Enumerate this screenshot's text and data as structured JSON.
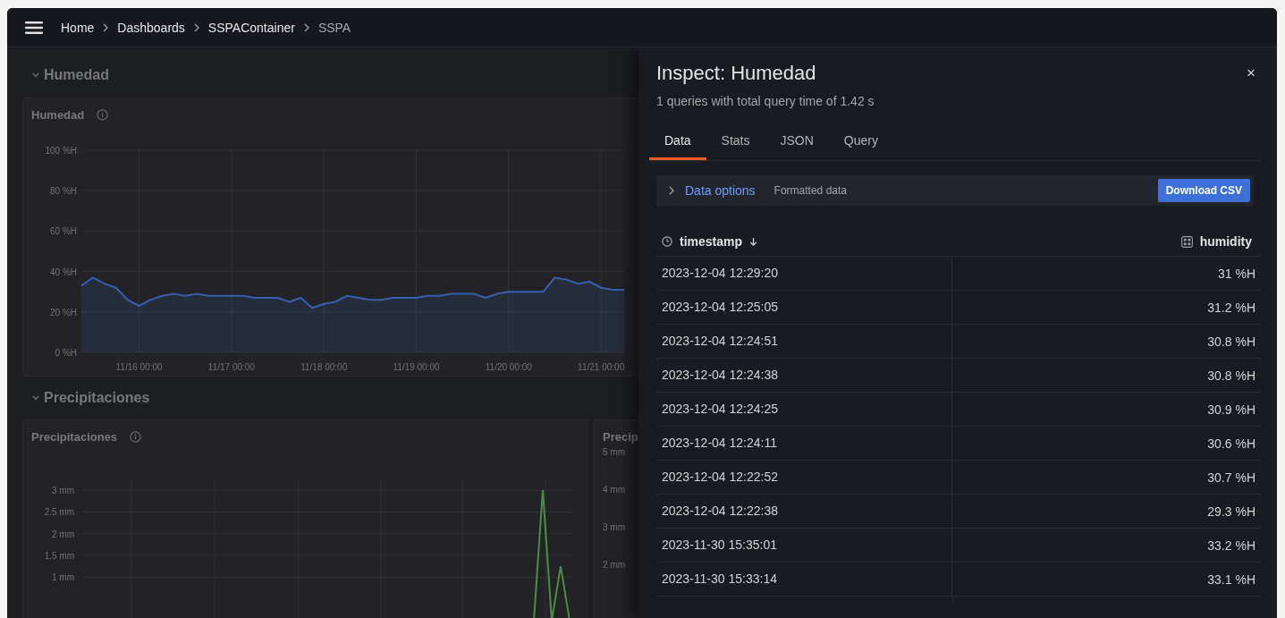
{
  "breadcrumbs": [
    {
      "label": "Home",
      "current": false
    },
    {
      "label": "Dashboards",
      "current": false
    },
    {
      "label": "SSPAContainer",
      "current": false
    },
    {
      "label": "SSPA",
      "current": true
    }
  ],
  "rows": [
    {
      "title": "Humedad",
      "expanded": true,
      "panels": [
        {
          "title": "Humedad",
          "chart_data": {
            "type": "area",
            "grid": true,
            "ylim": [
              0,
              100
            ],
            "yticks": [
              {
                "value": 0,
                "label": "0 %H"
              },
              {
                "value": 20,
                "label": "20 %H"
              },
              {
                "value": 40,
                "label": "40 %H"
              },
              {
                "value": 60,
                "label": "60 %H"
              },
              {
                "value": 80,
                "label": "80 %H"
              },
              {
                "value": 100,
                "label": "100 %H"
              }
            ],
            "categories": [
              null,
              null,
              null,
              null,
              null,
              "11/16 00:00",
              null,
              null,
              null,
              null,
              null,
              null,
              null,
              "11/17 00:00",
              null,
              null,
              null,
              null,
              null,
              null,
              null,
              "11/18 00:00",
              null,
              null,
              null,
              null,
              null,
              null,
              null,
              "11/19 00:00",
              null,
              null,
              null,
              null,
              null,
              null,
              null,
              "11/20 00:00",
              null,
              null,
              null,
              null,
              null,
              null,
              null,
              "11/21 00:00",
              null,
              null
            ],
            "series": [
              {
                "color": "#3d71d9",
                "values": [
                  33,
                  37,
                  34,
                  32,
                  26,
                  23,
                  26,
                  28,
                  29,
                  28,
                  29,
                  28,
                  28,
                  28,
                  28,
                  27,
                  27,
                  27,
                  25,
                  27,
                  22,
                  24,
                  25,
                  28,
                  27,
                  26,
                  26,
                  27,
                  27,
                  27,
                  28,
                  28,
                  29,
                  29,
                  29,
                  27,
                  29,
                  30,
                  30,
                  30,
                  30,
                  37,
                  36,
                  34,
                  35,
                  32,
                  31,
                  31
                ]
              }
            ]
          }
        }
      ]
    },
    {
      "title": "Precipitaciones",
      "expanded": true,
      "panels": [
        {
          "title": "Precipitaciones",
          "chart_data": {
            "type": "line",
            "grid": true,
            "ylim": [
              0,
              3.3
            ],
            "yticks": [
              {
                "value": 1,
                "label": "1 mm"
              },
              {
                "value": 1.5,
                "label": "1.5 mm"
              },
              {
                "value": 2,
                "label": "2 mm"
              },
              {
                "value": 2.5,
                "label": "2.5 mm"
              },
              {
                "value": 3,
                "label": "3 mm"
              }
            ],
            "series": [
              {
                "color": "#56a64b",
                "values": [
                  null,
                  null,
                  null,
                  null,
                  null,
                  null,
                  null,
                  null,
                  null,
                  null,
                  null,
                  null,
                  null,
                  null,
                  null,
                  null,
                  null,
                  null,
                  null,
                  null,
                  null,
                  null,
                  null,
                  null,
                  null,
                  null,
                  null,
                  null,
                  null,
                  null,
                  null,
                  null,
                  null,
                  null,
                  null,
                  null,
                  null,
                  null,
                  null,
                  null,
                  null,
                  null,
                  null,
                  null,
                  null,
                  null,
                  null,
                  null,
                  null,
                  null,
                  null,
                  0,
                  3,
                  0,
                  1.25,
                  0
                ]
              }
            ]
          }
        },
        {
          "title": "Precip",
          "axis_labels": [
            "5 mm",
            "4 mm",
            "3 mm",
            "2 mm"
          ]
        }
      ]
    }
  ],
  "inspect": {
    "title": "Inspect: Humedad",
    "close": "×",
    "subtitle": "1 queries with total query time of 1.42 s",
    "tabs": [
      {
        "label": "Data",
        "selected": true
      },
      {
        "label": "Stats",
        "selected": false
      },
      {
        "label": "JSON",
        "selected": false
      },
      {
        "label": "Query",
        "selected": false
      }
    ],
    "options": {
      "label": "Data options",
      "hint": "Formatted data",
      "button": "Download CSV"
    },
    "table": {
      "columns": [
        {
          "label": "timestamp",
          "kind": "time",
          "sorted": true
        },
        {
          "label": "humidity",
          "kind": "number",
          "sorted": false
        }
      ],
      "rows": [
        [
          "2023-12-04 12:29:20",
          "31 %H"
        ],
        [
          "2023-12-04 12:25:05",
          "31.2 %H"
        ],
        [
          "2023-12-04 12:24:51",
          "30.8 %H"
        ],
        [
          "2023-12-04 12:24:38",
          "30.8 %H"
        ],
        [
          "2023-12-04 12:24:25",
          "30.9 %H"
        ],
        [
          "2023-12-04 12:24:11",
          "30.6 %H"
        ],
        [
          "2023-12-04 12:22:52",
          "30.7 %H"
        ],
        [
          "2023-12-04 12:22:38",
          "29.3 %H"
        ],
        [
          "2023-11-30 15:35:01",
          "33.2 %H"
        ],
        [
          "2023-11-30 15:33:14",
          "33.1 %H"
        ]
      ]
    }
  }
}
